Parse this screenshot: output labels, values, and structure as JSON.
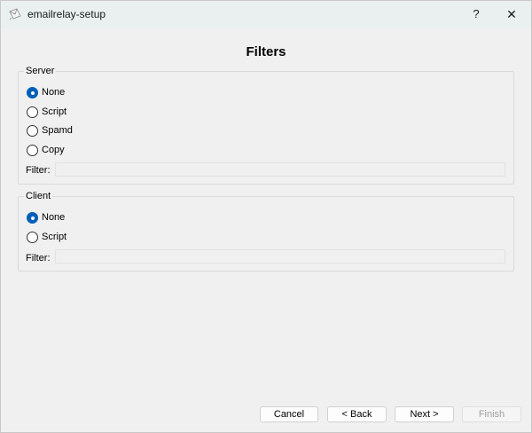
{
  "window": {
    "title": "emailrelay-setup",
    "help_label": "?",
    "close_label": "✕"
  },
  "page": {
    "title": "Filters"
  },
  "server": {
    "legend": "Server",
    "options": [
      {
        "label": "None",
        "checked": true
      },
      {
        "label": "Script",
        "checked": false
      },
      {
        "label": "Spamd",
        "checked": false
      },
      {
        "label": "Copy",
        "checked": false
      }
    ],
    "filter_label": "Filter:",
    "filter_value": ""
  },
  "client": {
    "legend": "Client",
    "options": [
      {
        "label": "None",
        "checked": true
      },
      {
        "label": "Script",
        "checked": false
      }
    ],
    "filter_label": "Filter:",
    "filter_value": ""
  },
  "buttons": {
    "cancel": "Cancel",
    "back": "< Back",
    "next": "Next >",
    "finish": "Finish",
    "finish_enabled": false
  },
  "colors": {
    "accent": "#005fb8",
    "titlebar": "#e9f0ef",
    "dialog_bg": "#f0f0f0"
  }
}
